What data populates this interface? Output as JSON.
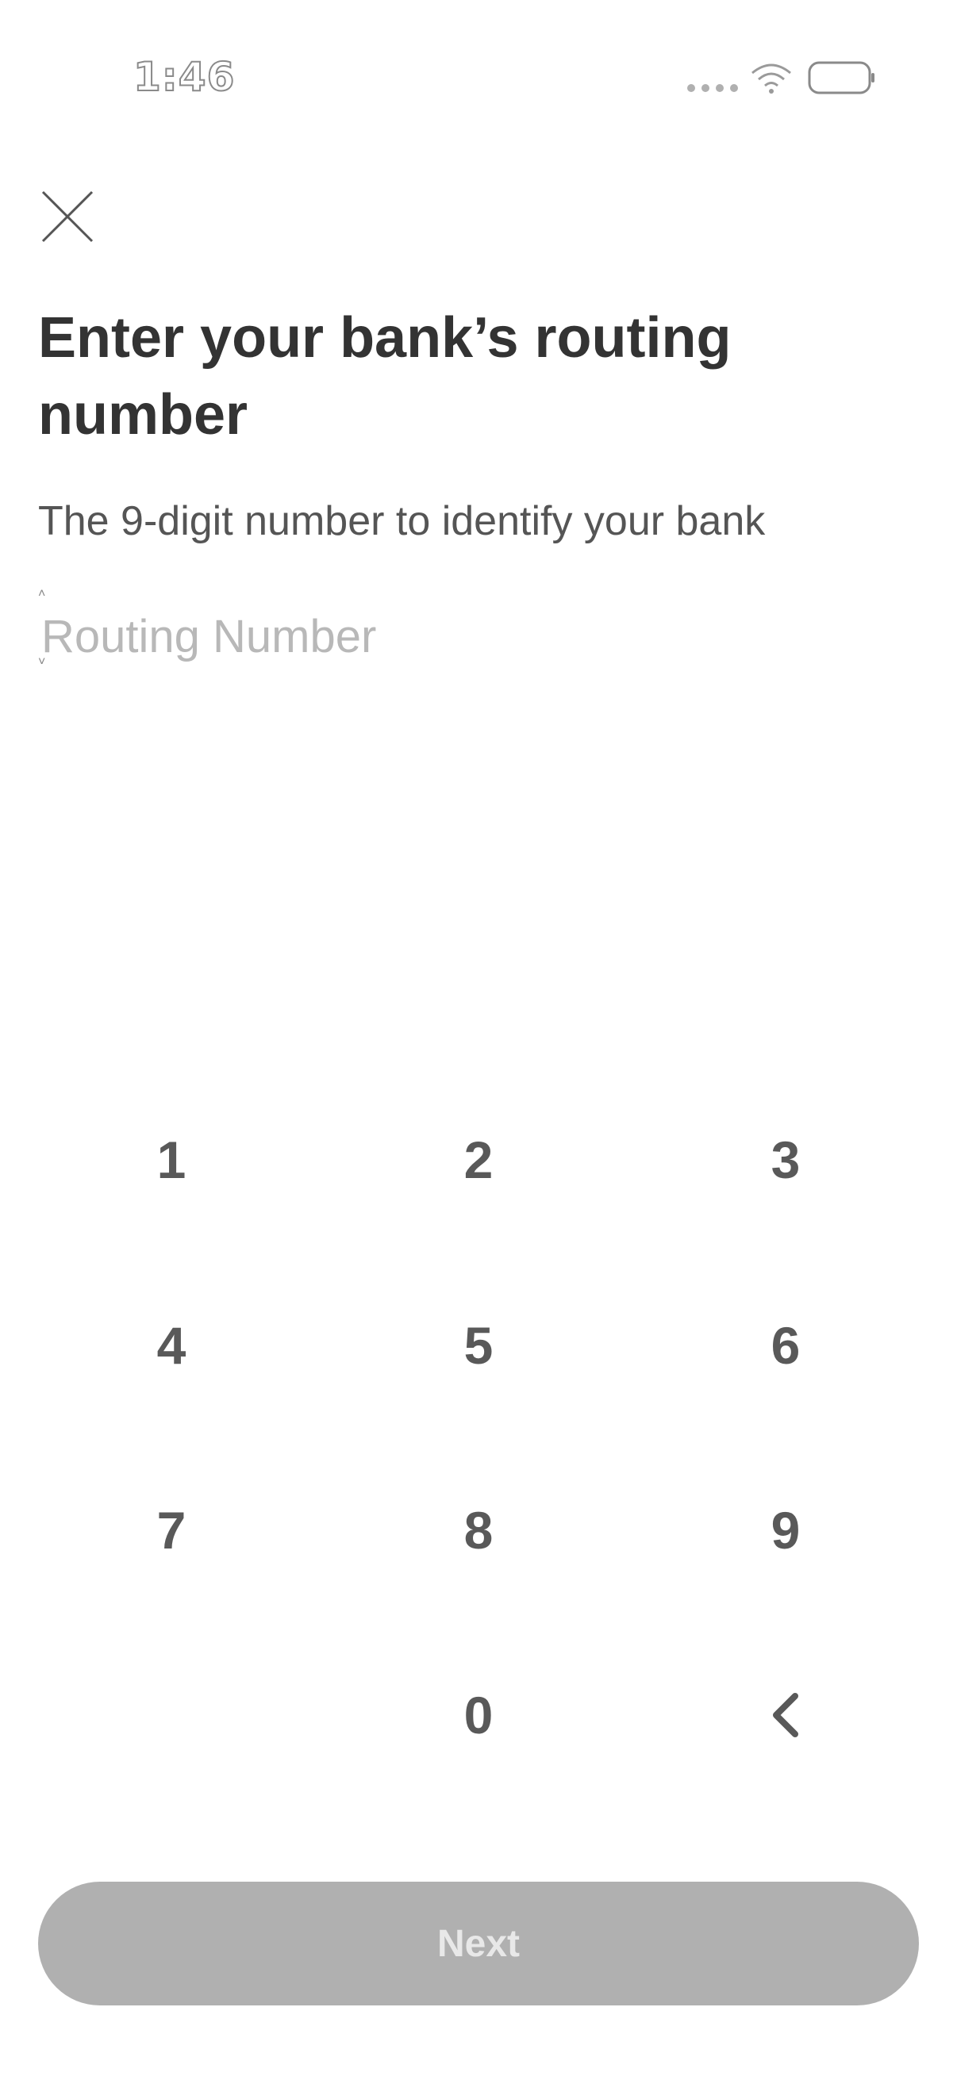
{
  "status_bar": {
    "time": "1:46",
    "icons": [
      "signal-dots-icon",
      "wifi-icon",
      "battery-icon"
    ]
  },
  "header": {
    "close_icon": "close-icon"
  },
  "main": {
    "title": "Enter your bank’s routing number",
    "subtitle": "The 9-digit number to identify your bank",
    "routing_input": {
      "placeholder": "Routing Number",
      "value": ""
    }
  },
  "keypad": {
    "keys": [
      "1",
      "2",
      "3",
      "4",
      "5",
      "6",
      "7",
      "8",
      "9",
      "0"
    ],
    "backspace_icon": "chevron-left-icon"
  },
  "footer": {
    "next_label": "Next",
    "next_enabled": false
  },
  "colors": {
    "title": "#333333",
    "subtitle": "#555555",
    "placeholder": "#b8b8b8",
    "key": "#595959",
    "button_disabled_bg": "#b0b0b0",
    "button_disabled_text": "#e8e8e8"
  }
}
